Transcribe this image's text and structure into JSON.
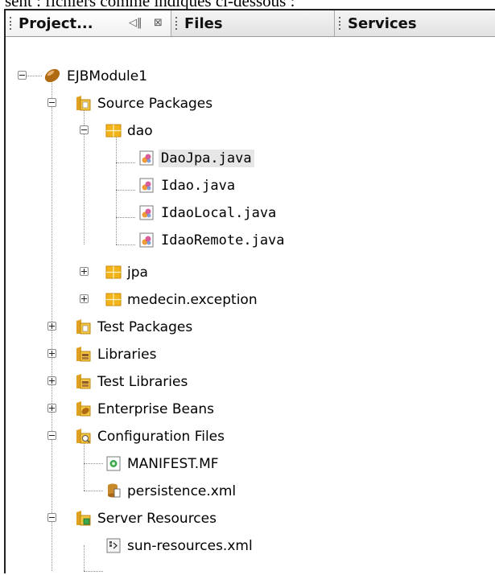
{
  "caption": "sent : fichiers comme indiqués ci-dessous :",
  "tabs": [
    {
      "label": "Project...",
      "active": true
    },
    {
      "label": "Files",
      "active": false
    },
    {
      "label": "Services",
      "active": false
    }
  ],
  "tree": {
    "ejbmodule": "EJBModule1",
    "source_packages": "Source Packages",
    "dao": "dao",
    "daojpa": "DaoJpa.java",
    "idao": "Idao.java",
    "idaolocal": "IdaoLocal.java",
    "idaoremote": "IdaoRemote.java",
    "jpa": "jpa",
    "medecin_exception": "medecin.exception",
    "test_packages": "Test Packages",
    "libraries": "Libraries",
    "test_libraries": "Test Libraries",
    "enterprise_beans": "Enterprise Beans",
    "configuration_files": "Configuration Files",
    "manifest": "MANIFEST.MF",
    "persistence": "persistence.xml",
    "server_resources": "Server Resources",
    "sun_resources": "sun-resources.xml"
  },
  "colors": {
    "selection": "#e6e6e6",
    "package": "#f0b400",
    "folder": "#f2c23a"
  }
}
